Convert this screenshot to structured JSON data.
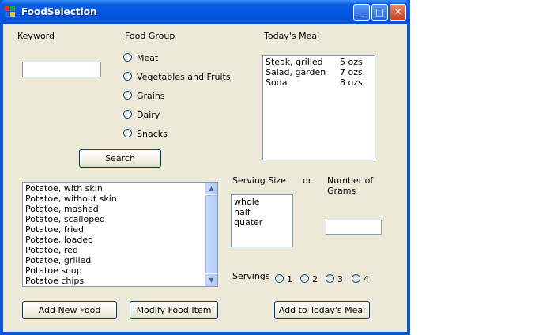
{
  "window": {
    "title": "FoodSelection"
  },
  "labels": {
    "keyword": "Keyword",
    "food_group": "Food Group",
    "todays_meal": "Today's Meal",
    "serving_size": "Serving Size",
    "or": "or",
    "number_of_grams": "Number of Grams",
    "servings": "Servings"
  },
  "keyword_input": {
    "value": ""
  },
  "grams_input": {
    "value": ""
  },
  "food_groups": [
    "Meat",
    "Vegetables and Fruits",
    "Grains",
    "Dairy",
    "Snacks"
  ],
  "todays_meal": [
    {
      "name": "Steak, grilled",
      "amount": "5 ozs"
    },
    {
      "name": "Salad, garden",
      "amount": "7 ozs"
    },
    {
      "name": "Soda",
      "amount": "8 ozs"
    }
  ],
  "food_list": [
    "Potatoe, with skin",
    "Potatoe, without skin",
    "Potatoe, mashed",
    "Potatoe, scalloped",
    "Potatoe, fried",
    "Potatoe, loaded",
    "Potatoe, red",
    "Potatoe, grilled",
    "Potatoe soup",
    "Potatoe chips"
  ],
  "serving_sizes": [
    "whole",
    "half",
    "quater"
  ],
  "servings_options": [
    "1",
    "2",
    "3",
    "4"
  ],
  "buttons": {
    "search": "Search",
    "add_new_food": "Add New Food",
    "modify_food_item": "Modify Food Item",
    "add_to_todays_meal": "Add to Today's Meal"
  },
  "colors": {
    "titlebar": "#0456e4",
    "client_bg": "#ece9d8",
    "border": "#7f9db9"
  }
}
